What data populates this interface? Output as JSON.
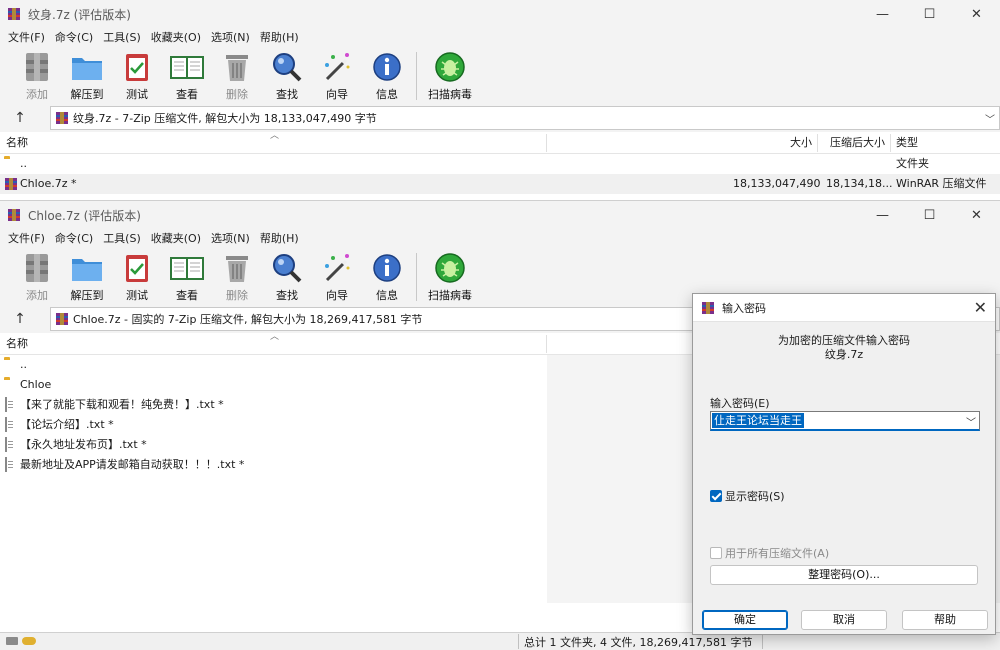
{
  "window1": {
    "title": "纹身.7z (评估版本)",
    "menu": [
      "文件(F)",
      "命令(C)",
      "工具(S)",
      "收藏夹(O)",
      "选项(N)",
      "帮助(H)"
    ],
    "toolbar": [
      "添加",
      "解压到",
      "测试",
      "查看",
      "删除",
      "查找",
      "向导",
      "信息",
      "扫描病毒"
    ],
    "address": "纹身.7z - 7-Zip 压缩文件, 解包大小为 18,133,047,490 字节",
    "columns": {
      "name": "名称",
      "size": "大小",
      "packed": "压缩后大小",
      "type": "类型"
    },
    "rows": [
      {
        "name": "..",
        "size": "",
        "packed": "",
        "type": "文件夹"
      },
      {
        "name": "Chloe.7z *",
        "size": "18,133,047,490",
        "packed": "18,134,18...",
        "type": "WinRAR 压缩文件"
      }
    ]
  },
  "window2": {
    "title": "Chloe.7z (评估版本)",
    "menu": [
      "文件(F)",
      "命令(C)",
      "工具(S)",
      "收藏夹(O)",
      "选项(N)",
      "帮助(H)"
    ],
    "toolbar": [
      "添加",
      "解压到",
      "测试",
      "查看",
      "删除",
      "查找",
      "向导",
      "信息",
      "扫描病毒"
    ],
    "address": "Chloe.7z - 固实的 7-Zip 压缩文件, 解包大小为 18,269,417,581 字节",
    "columns": {
      "name": "名称"
    },
    "rows": [
      {
        "name": "..",
        "kind": "folder"
      },
      {
        "name": "Chloe",
        "kind": "folder"
      },
      {
        "name": "【来了就能下载和观看！纯免费！】.txt *",
        "kind": "doc"
      },
      {
        "name": "【论坛介绍】.txt *",
        "kind": "doc"
      },
      {
        "name": "【永久地址发布页】.txt *",
        "kind": "doc"
      },
      {
        "name": "最新地址及APP请发邮箱自动获取！！！.txt *",
        "kind": "doc"
      }
    ],
    "status": "总计 1 文件夹, 4 文件, 18,269,417,581 字节"
  },
  "dialog": {
    "title": "输入密码",
    "prompt_line1": "为加密的压缩文件输入密码",
    "prompt_line2": "纹身.7z",
    "password_label": "输入密码(E)",
    "password_value": "仩走王论坛当走王",
    "show_password_label": "显示密码(S)",
    "show_password_checked": true,
    "all_archives_label": "用于所有压缩文件(A)",
    "all_archives_checked": false,
    "organize_button": "整理密码(O)...",
    "ok_button": "确定",
    "cancel_button": "取消",
    "help_button": "帮助"
  },
  "colors": {
    "accent": "#0067c0",
    "folder": "#f4c14e"
  }
}
